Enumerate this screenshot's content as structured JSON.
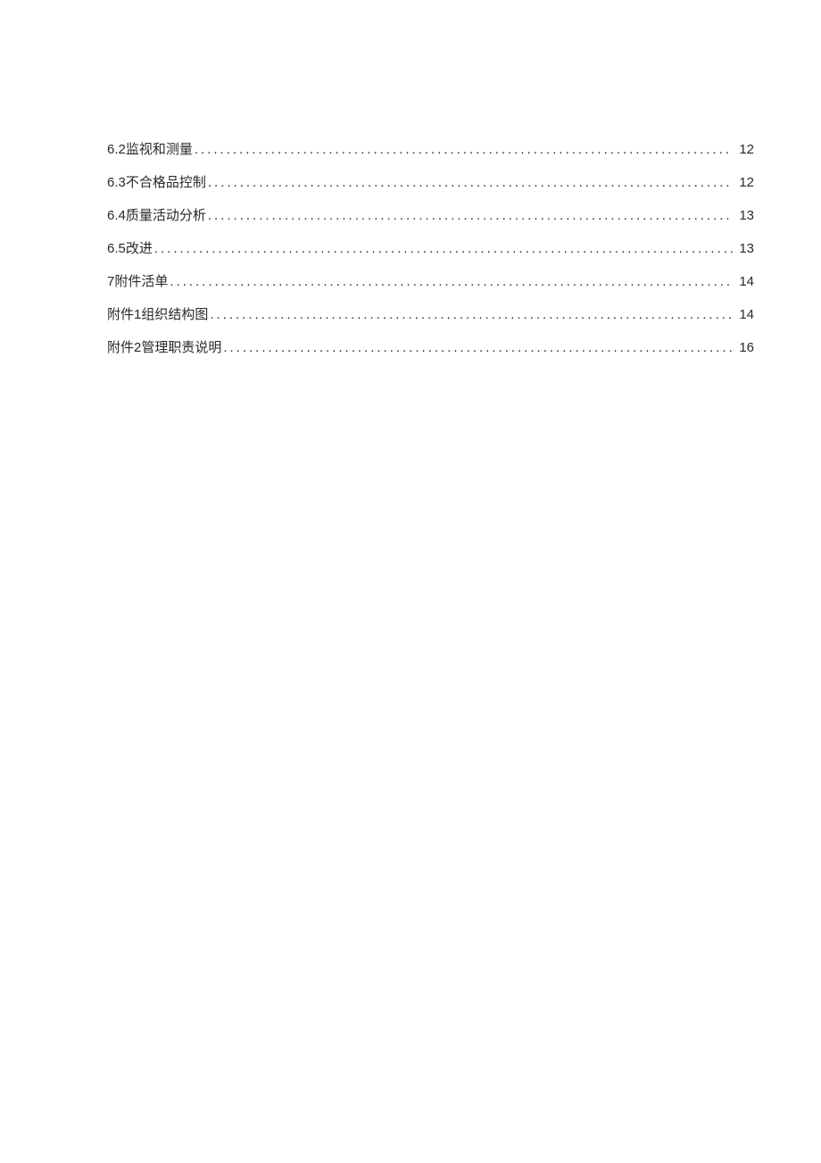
{
  "groups": [
    {
      "items": [
        {
          "label": "6.2监视和测量",
          "page": "12"
        },
        {
          "label": "6.3不合格品控制",
          "page": "12"
        },
        {
          "label": "6.4质量活动分析",
          "page": "13"
        },
        {
          "label": "6.5改进",
          "page": "13"
        }
      ]
    },
    {
      "items": [
        {
          "label": "7附件活单",
          "page": "14"
        },
        {
          "label": "附件1组织结构图",
          "page": "14"
        },
        {
          "label": "附件2管理职责说明",
          "page": "16"
        }
      ]
    }
  ]
}
